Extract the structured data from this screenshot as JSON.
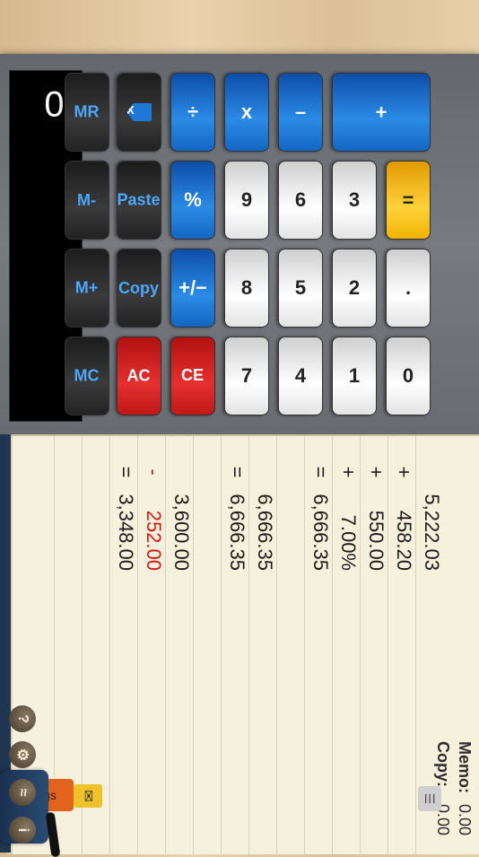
{
  "display": {
    "value": "0"
  },
  "keys": {
    "mc": "MC",
    "mplus": "M+",
    "mminus": "M-",
    "mr": "MR",
    "ac": "AC",
    "copy": "Copy",
    "paste": "Paste",
    "backspace": "X",
    "ce": "CE",
    "plusminus": "+/−",
    "percent": "%",
    "divide": "÷",
    "d7": "7",
    "d8": "8",
    "d9": "9",
    "multiply": "x",
    "d4": "4",
    "d5": "5",
    "d6": "6",
    "minus": "–",
    "d1": "1",
    "d2": "2",
    "d3": "3",
    "plus": "+",
    "d0": "0",
    "dot": ".",
    "equals": "="
  },
  "tape": [
    {
      "value": "5,222.03",
      "op": "",
      "color": "black"
    },
    {
      "value": "458.20",
      "op": "+",
      "color": "black"
    },
    {
      "value": "550.00",
      "op": "+",
      "color": "black"
    },
    {
      "value": "7.00%",
      "op": "+",
      "color": "black"
    },
    {
      "value": "6,666.35",
      "op": "=",
      "color": "black"
    },
    {
      "value": "",
      "op": "",
      "color": "black"
    },
    {
      "value": "6,666.35",
      "op": "",
      "color": "black"
    },
    {
      "value": "6,666.35",
      "op": "=",
      "color": "black"
    },
    {
      "value": "",
      "op": "",
      "color": "black"
    },
    {
      "value": "3,600.00",
      "op": "",
      "color": "black"
    },
    {
      "value": "252.00",
      "op": "-",
      "color": "red"
    },
    {
      "value": "3,348.00",
      "op": "=",
      "color": "black"
    }
  ],
  "memo": {
    "label": "Memo:",
    "value": "0.00"
  },
  "copy": {
    "label": "Copy:",
    "value": "0.00"
  },
  "tabs": {
    "logs": "logs"
  },
  "toolbar": {
    "info_icon": "info-icon",
    "wifi_icon": "share-icon",
    "settings_icon": "gear-icon",
    "help_icon": "help-icon"
  }
}
